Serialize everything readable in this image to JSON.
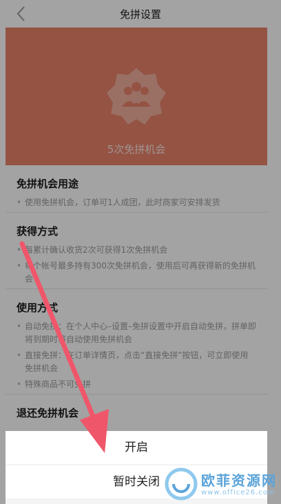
{
  "header": {
    "title": "免拼设置"
  },
  "hero": {
    "count_text": "5次免拼机会"
  },
  "sections": [
    {
      "heading": "免拼机会用途",
      "items": [
        "使用免拼机会，订单可1人成团，此时商家可安排发货"
      ]
    },
    {
      "heading": "获得方式",
      "items": [
        "每累计确认收货2次可获得1次免拼机会",
        "每个帐号最多持有300次免拼机会，使用后可再获得新的免拼机会"
      ]
    },
    {
      "heading": "使用方式",
      "items": [
        "自动免拼：在个人中心–设置–免拼设置中开启自动免拼，拼单即将到期时将自动使用免拼机会",
        "直接免拼：在订单详情页，点击“直接免拼”按钮，可立即使用免拼机会",
        "特殊商品不可免拼"
      ]
    },
    {
      "heading": "退还免拼机会",
      "items": []
    }
  ],
  "sheet": {
    "open_label": "开启",
    "pause_label": "暂时关闭"
  },
  "watermark": {
    "text": "欧菲资源网",
    "url": "www.office26.com"
  },
  "colors": {
    "hero_bg": "#e8826a",
    "arrow": "#f0566a",
    "watermark": "#5aa3d9"
  },
  "icons": {
    "back": "chevron-left-icon",
    "group": "group-badge-icon"
  }
}
